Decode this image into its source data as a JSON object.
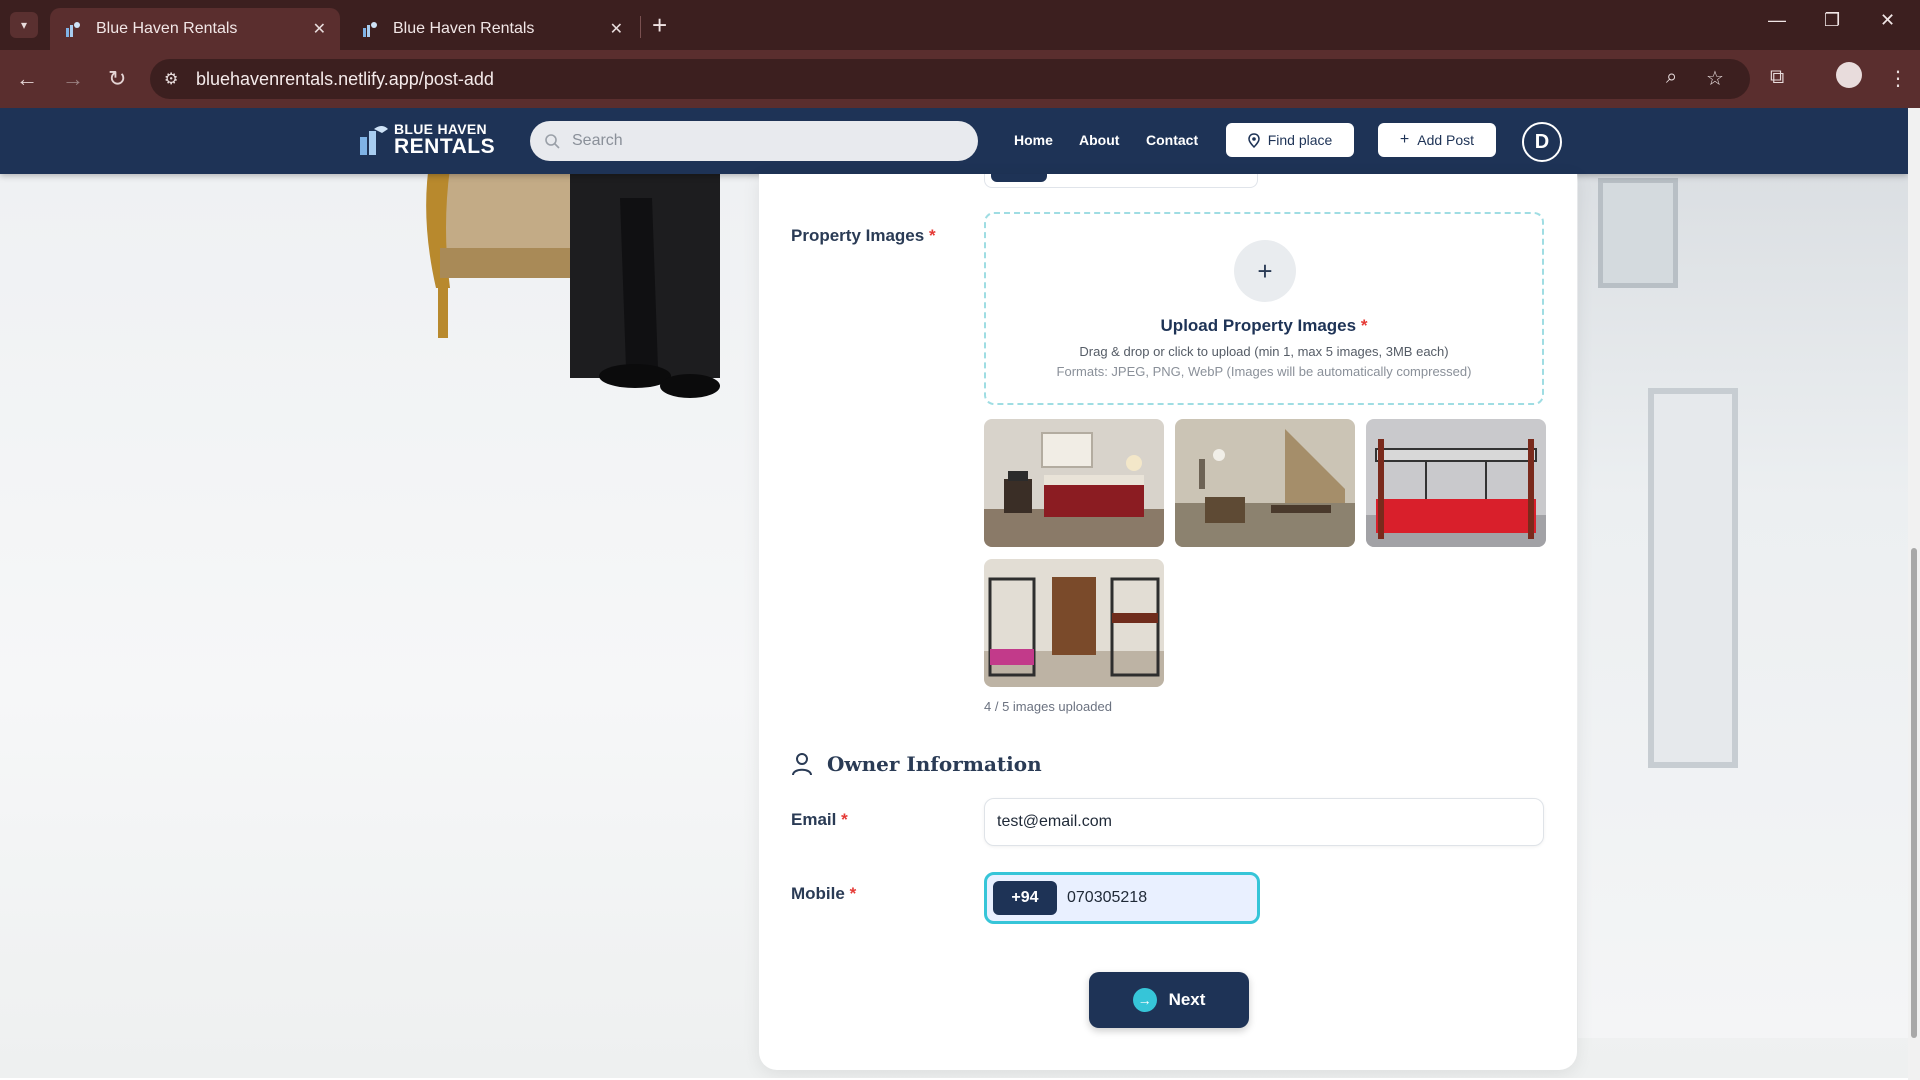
{
  "browser": {
    "tabs": [
      {
        "title": "Blue Haven Rentals",
        "active": true
      },
      {
        "title": "Blue Haven Rentals",
        "active": false
      }
    ],
    "url": "bluehavenrentals.netlify.app/post-add"
  },
  "navbar": {
    "logo_line1": "BLUE HAVEN",
    "logo_line2": "RENTALS",
    "search_placeholder": "Search",
    "links": [
      "Home",
      "About",
      "Contact"
    ],
    "find_place_label": "Find place",
    "add_post_label": "Add Post",
    "avatar_initial": "D"
  },
  "form": {
    "images": {
      "label": "Property Images",
      "required_mark": "*",
      "upload_title": "Upload Property Images",
      "upload_subtitle": "Drag & drop or click to upload (min 1, max 5 images, 3MB each)",
      "upload_formats": "Formats: JPEG, PNG, WebP (Images will be automatically compressed)",
      "thumbnails": [
        "bedroom-photo",
        "living-room-photo",
        "bunk-bed-photo",
        "dorm-room-photo"
      ],
      "count_text": "4 / 5 images uploaded"
    },
    "owner": {
      "section_title": "Owner Information",
      "email_label": "Email",
      "email_value": "test@email.com",
      "mobile_label": "Mobile",
      "country_code": "+94",
      "mobile_value": "070305218"
    },
    "next_label": "Next"
  },
  "colors": {
    "brand_navy": "#1e3356",
    "accent_cyan": "#36c5d8",
    "required_red": "#e53935"
  }
}
